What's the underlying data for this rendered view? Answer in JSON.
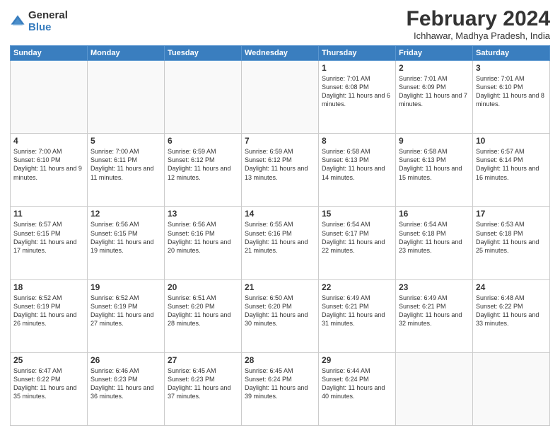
{
  "header": {
    "logo_general": "General",
    "logo_blue": "Blue",
    "month_year": "February 2024",
    "location": "Ichhawar, Madhya Pradesh, India"
  },
  "weekdays": [
    "Sunday",
    "Monday",
    "Tuesday",
    "Wednesday",
    "Thursday",
    "Friday",
    "Saturday"
  ],
  "weeks": [
    [
      {
        "day": "",
        "info": ""
      },
      {
        "day": "",
        "info": ""
      },
      {
        "day": "",
        "info": ""
      },
      {
        "day": "",
        "info": ""
      },
      {
        "day": "1",
        "info": "Sunrise: 7:01 AM\nSunset: 6:08 PM\nDaylight: 11 hours and 6 minutes."
      },
      {
        "day": "2",
        "info": "Sunrise: 7:01 AM\nSunset: 6:09 PM\nDaylight: 11 hours and 7 minutes."
      },
      {
        "day": "3",
        "info": "Sunrise: 7:01 AM\nSunset: 6:10 PM\nDaylight: 11 hours and 8 minutes."
      }
    ],
    [
      {
        "day": "4",
        "info": "Sunrise: 7:00 AM\nSunset: 6:10 PM\nDaylight: 11 hours and 9 minutes."
      },
      {
        "day": "5",
        "info": "Sunrise: 7:00 AM\nSunset: 6:11 PM\nDaylight: 11 hours and 11 minutes."
      },
      {
        "day": "6",
        "info": "Sunrise: 6:59 AM\nSunset: 6:12 PM\nDaylight: 11 hours and 12 minutes."
      },
      {
        "day": "7",
        "info": "Sunrise: 6:59 AM\nSunset: 6:12 PM\nDaylight: 11 hours and 13 minutes."
      },
      {
        "day": "8",
        "info": "Sunrise: 6:58 AM\nSunset: 6:13 PM\nDaylight: 11 hours and 14 minutes."
      },
      {
        "day": "9",
        "info": "Sunrise: 6:58 AM\nSunset: 6:13 PM\nDaylight: 11 hours and 15 minutes."
      },
      {
        "day": "10",
        "info": "Sunrise: 6:57 AM\nSunset: 6:14 PM\nDaylight: 11 hours and 16 minutes."
      }
    ],
    [
      {
        "day": "11",
        "info": "Sunrise: 6:57 AM\nSunset: 6:15 PM\nDaylight: 11 hours and 17 minutes."
      },
      {
        "day": "12",
        "info": "Sunrise: 6:56 AM\nSunset: 6:15 PM\nDaylight: 11 hours and 19 minutes."
      },
      {
        "day": "13",
        "info": "Sunrise: 6:56 AM\nSunset: 6:16 PM\nDaylight: 11 hours and 20 minutes."
      },
      {
        "day": "14",
        "info": "Sunrise: 6:55 AM\nSunset: 6:16 PM\nDaylight: 11 hours and 21 minutes."
      },
      {
        "day": "15",
        "info": "Sunrise: 6:54 AM\nSunset: 6:17 PM\nDaylight: 11 hours and 22 minutes."
      },
      {
        "day": "16",
        "info": "Sunrise: 6:54 AM\nSunset: 6:18 PM\nDaylight: 11 hours and 23 minutes."
      },
      {
        "day": "17",
        "info": "Sunrise: 6:53 AM\nSunset: 6:18 PM\nDaylight: 11 hours and 25 minutes."
      }
    ],
    [
      {
        "day": "18",
        "info": "Sunrise: 6:52 AM\nSunset: 6:19 PM\nDaylight: 11 hours and 26 minutes."
      },
      {
        "day": "19",
        "info": "Sunrise: 6:52 AM\nSunset: 6:19 PM\nDaylight: 11 hours and 27 minutes."
      },
      {
        "day": "20",
        "info": "Sunrise: 6:51 AM\nSunset: 6:20 PM\nDaylight: 11 hours and 28 minutes."
      },
      {
        "day": "21",
        "info": "Sunrise: 6:50 AM\nSunset: 6:20 PM\nDaylight: 11 hours and 30 minutes."
      },
      {
        "day": "22",
        "info": "Sunrise: 6:49 AM\nSunset: 6:21 PM\nDaylight: 11 hours and 31 minutes."
      },
      {
        "day": "23",
        "info": "Sunrise: 6:49 AM\nSunset: 6:21 PM\nDaylight: 11 hours and 32 minutes."
      },
      {
        "day": "24",
        "info": "Sunrise: 6:48 AM\nSunset: 6:22 PM\nDaylight: 11 hours and 33 minutes."
      }
    ],
    [
      {
        "day": "25",
        "info": "Sunrise: 6:47 AM\nSunset: 6:22 PM\nDaylight: 11 hours and 35 minutes."
      },
      {
        "day": "26",
        "info": "Sunrise: 6:46 AM\nSunset: 6:23 PM\nDaylight: 11 hours and 36 minutes."
      },
      {
        "day": "27",
        "info": "Sunrise: 6:45 AM\nSunset: 6:23 PM\nDaylight: 11 hours and 37 minutes."
      },
      {
        "day": "28",
        "info": "Sunrise: 6:45 AM\nSunset: 6:24 PM\nDaylight: 11 hours and 39 minutes."
      },
      {
        "day": "29",
        "info": "Sunrise: 6:44 AM\nSunset: 6:24 PM\nDaylight: 11 hours and 40 minutes."
      },
      {
        "day": "",
        "info": ""
      },
      {
        "day": "",
        "info": ""
      }
    ]
  ]
}
